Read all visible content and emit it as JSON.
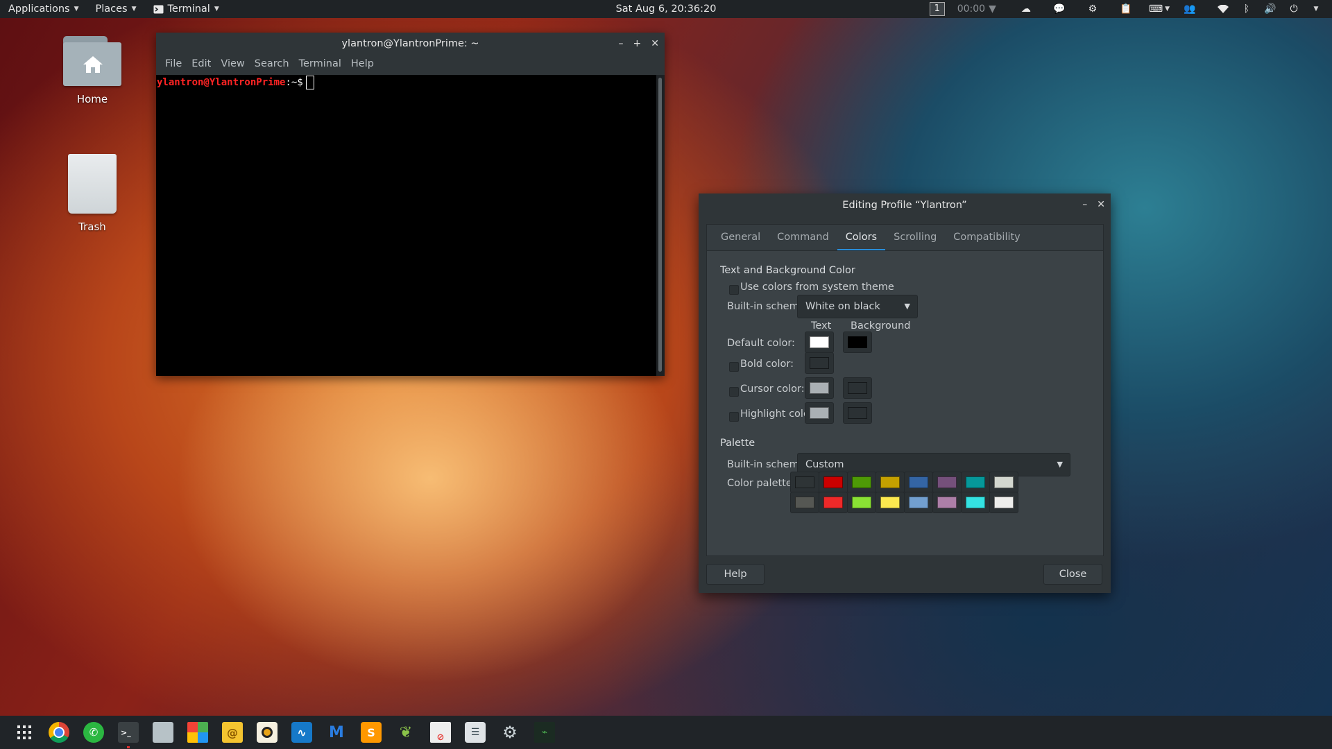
{
  "topbar": {
    "applications": "Applications",
    "places": "Places",
    "terminal_app": "Terminal",
    "clock": "Sat Aug  6, 20:36:20",
    "workspace": "1",
    "timer": "00:00",
    "tray_icons": [
      "cloud-icon",
      "chat-icon",
      "gear-icon",
      "clipboard-icon",
      "keyboard-layout-icon",
      "people-icon",
      "wifi-icon",
      "bluetooth-icon",
      "volume-icon",
      "power-icon"
    ]
  },
  "desktop": {
    "home_label": "Home",
    "trash_label": "Trash"
  },
  "terminal": {
    "title": "ylantron@YlantronPrime: ~",
    "menu": [
      "File",
      "Edit",
      "View",
      "Search",
      "Terminal",
      "Help"
    ],
    "prompt_user": "ylantron@YlantronPrime",
    "prompt_rest": ":~$"
  },
  "dialog": {
    "title": "Editing Profile “Ylantron”",
    "tabs": [
      "General",
      "Command",
      "Colors",
      "Scrolling",
      "Compatibility"
    ],
    "active_tab": "Colors",
    "text_bg_title": "Text and Background Color",
    "use_system": "Use colors from system theme",
    "builtin_label": "Built-in schemes:",
    "builtin_value": "White on black",
    "col_text": "Text",
    "col_background": "Background",
    "default_color": "Default color:",
    "bold_color": "Bold color:",
    "cursor_color": "Cursor color:",
    "highlight_color": "Highlight color:",
    "swatches": {
      "default_text": "#ffffff",
      "default_bg": "#000000",
      "bold": "#2b3134",
      "cursor_text": "#aab0b4",
      "cursor_bg": "#2b3134",
      "highlight_text": "#aab0b4",
      "highlight_bg": "#2b3134"
    },
    "palette_title": "Palette",
    "palette_builtin_label": "Built-in schemes:",
    "palette_builtin_value": "Custom",
    "color_palette_label": "Color palette:",
    "palette_row1": [
      "#2e3436",
      "#cc0000",
      "#4e9a06",
      "#c4a000",
      "#3465a4",
      "#75507b",
      "#06989a",
      "#d3d7cf"
    ],
    "palette_row2": [
      "#555753",
      "#ef2929",
      "#8ae234",
      "#fce94f",
      "#729fcf",
      "#ad7fa8",
      "#34e2e2",
      "#eeeeec"
    ],
    "help": "Help",
    "close": "Close"
  },
  "dock": {
    "apps": [
      "app-grid",
      "chrome",
      "whatsapp",
      "terminal",
      "files",
      "gnome-software",
      "mail",
      "rhythmbox",
      "wireshark",
      "malwarebytes",
      "sublime",
      "leafpad",
      "document-viewer",
      "settings-panel",
      "system-settings",
      "system-monitor"
    ]
  }
}
